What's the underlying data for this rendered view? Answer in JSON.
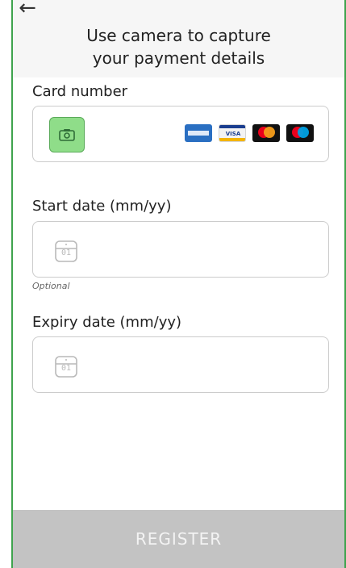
{
  "header": {
    "back_icon": "arrow-left-icon",
    "title_line1": "Use camera to capture",
    "title_line2": "your payment details"
  },
  "card_number": {
    "label": "Card number",
    "camera_icon": "camera-icon",
    "logos": [
      "amex-icon",
      "visa-icon",
      "mastercard-icon",
      "maestro-icon"
    ],
    "visa_text": "VISA"
  },
  "start_date": {
    "label": "Start date (mm/yy)",
    "calendar_text": "01",
    "helper": "Optional"
  },
  "expiry_date": {
    "label": "Expiry date (mm/yy)",
    "calendar_text": "01"
  },
  "footer": {
    "register_label": "REGISTER"
  },
  "colors": {
    "accent_green": "#3fa34d",
    "camera_bg": "#8fdd89",
    "register_bg": "#c3c3c3"
  }
}
